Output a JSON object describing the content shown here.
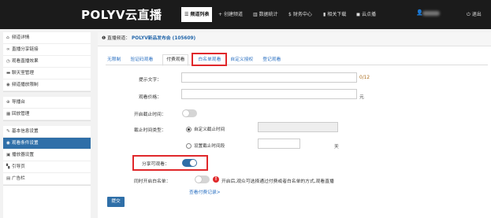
{
  "topbar": {
    "logo": "POLYV云直播",
    "nav": [
      {
        "icon": "list-icon",
        "glyph": "☰",
        "label": "频道列表",
        "active": true
      },
      {
        "icon": "plus-icon",
        "glyph": "+",
        "label": "创建频道",
        "active": false
      },
      {
        "icon": "bar-chart-icon",
        "glyph": "▥",
        "label": "数据统计",
        "active": false
      },
      {
        "icon": "dollar-icon",
        "glyph": "$",
        "label": "财务中心",
        "active": false
      },
      {
        "icon": "download-icon",
        "glyph": "▮",
        "label": "相关下载",
        "active": false
      },
      {
        "icon": "cloud-icon",
        "glyph": "◼",
        "label": "云点播",
        "active": false
      }
    ],
    "user_icon": "user-icon",
    "logout_icon": "power-icon",
    "logout_label": "退出"
  },
  "sidebar": {
    "groups": [
      [
        {
          "icon": "home-icon",
          "glyph": "⌂",
          "label": "频道详情"
        },
        {
          "icon": "link-icon",
          "glyph": "∞",
          "label": "直播分享链接"
        },
        {
          "icon": "clock-icon",
          "glyph": "◷",
          "label": "观看直播效果"
        },
        {
          "icon": "chat-icon",
          "glyph": "▬",
          "label": "聊天室管理"
        },
        {
          "icon": "eye-icon",
          "glyph": "◉",
          "label": "频道播放限制"
        }
      ],
      [
        {
          "icon": "globe-icon",
          "glyph": "⊕",
          "label": "导播台"
        },
        {
          "icon": "grid-icon",
          "glyph": "▦",
          "label": "回放管理"
        }
      ],
      [
        {
          "icon": "pencil-icon",
          "glyph": "✎",
          "label": "基本信息设置"
        },
        {
          "icon": "eye-icon",
          "glyph": "◉",
          "label": "观看条件设置",
          "active": true
        },
        {
          "icon": "play-icon",
          "glyph": "▣",
          "label": "播放器设置"
        },
        {
          "icon": "flag-icon",
          "glyph": "▚",
          "label": "引导页"
        },
        {
          "icon": "image-icon",
          "glyph": "▤",
          "label": "广告栏"
        }
      ]
    ]
  },
  "breadcrumb": {
    "icon": "info-icon",
    "prefix": "❶ 直播频道：",
    "value": "POLYV新品发布会 (105609)"
  },
  "tabs": [
    "无限制",
    "验证码观看",
    "付费观看",
    "白名单观看",
    "自定义授权",
    "登记观看"
  ],
  "form": {
    "tip_label": "提示文字：",
    "tip_value": "",
    "tip_counter": "0/12",
    "price_label": "观看价格：",
    "price_value": "",
    "price_unit": "元",
    "deadline_toggle_label": "开启截止时间：",
    "deadline_toggle_on": false,
    "deadline_type_label": "截止时间类型：",
    "deadline_options": [
      {
        "label": "自定义截止时间",
        "checked": true
      },
      {
        "label": "设置截止时间段",
        "checked": false
      }
    ],
    "custom_deadline_value": "",
    "period_value": "",
    "period_unit": "天",
    "share_label": "分享可观看：",
    "share_on": true,
    "whitelist_label": "同时开启白名单：",
    "whitelist_on": false,
    "whitelist_hint": "开启后,观众可选择通过付费或者白名单的方式,观看直播",
    "records_link": "查看付费记录>",
    "submit_label": "提交"
  }
}
